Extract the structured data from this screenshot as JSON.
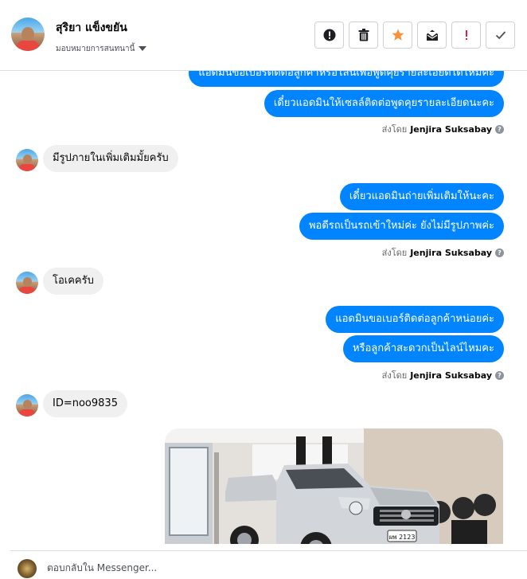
{
  "header": {
    "contact_name": "สุริยา แข็งขยัน",
    "assign_label": "มอบหมายการสนทนานี้",
    "actions": [
      {
        "name": "mark-spam-button",
        "icon": "exclamation-circle-icon"
      },
      {
        "name": "delete-button",
        "icon": "trash-icon"
      },
      {
        "name": "star-button",
        "icon": "star-icon"
      },
      {
        "name": "mark-unread-button",
        "icon": "envelope-open-icon"
      },
      {
        "name": "flag-button",
        "icon": "exclamation-icon"
      },
      {
        "name": "mark-done-button",
        "icon": "check-icon"
      }
    ]
  },
  "thread": {
    "messages": [
      {
        "dir": "out",
        "text": "แอดมินขอเบอร์ติดต่อลูกค้าหรือไลน์เพื่อพูดคุยรายละเอียดได้ไหมคะ"
      },
      {
        "dir": "out",
        "text": "เดี๋ยวแอดมินให้เซลล์ติดต่อพูดคุยรายละเอียดนะคะ"
      },
      {
        "dir": "sent",
        "label": "ส่งโดย",
        "sender": "Jenjira Suksabay"
      },
      {
        "dir": "in",
        "text": "มีรูปภายในเพิ่มเติมมั้ยครับ"
      },
      {
        "dir": "out",
        "text": "เดี๋ยวแอดมินถ่ายเพิ่มเติมให้นะคะ"
      },
      {
        "dir": "out",
        "text": "พอดีรถเป็นรถเข้าใหม่ค่ะ ยังไม่มีรูปภาพค่ะ"
      },
      {
        "dir": "sent",
        "label": "ส่งโดย",
        "sender": "Jenjira Suksabay"
      },
      {
        "dir": "in",
        "text": "โอเคครับ"
      },
      {
        "dir": "out",
        "text": "แอดมินขอเบอร์ติดต่อลูกค้าหน่อยค่ะ"
      },
      {
        "dir": "out",
        "text": "หรือลูกค้าสะดวกเป็นไลน์ไหมคะ"
      },
      {
        "dir": "sent",
        "label": "ส่งโดย",
        "sender": "Jenjira Suksabay"
      },
      {
        "dir": "in",
        "text": "ID=noo9835"
      }
    ],
    "photo": {
      "plate_text": "ผพ 2123"
    }
  },
  "composer": {
    "placeholder": "ตอบกลับใน Messenger..."
  },
  "colors": {
    "accent": "#0084ff",
    "star": "#f7923b",
    "flag": "#e41e3f"
  }
}
